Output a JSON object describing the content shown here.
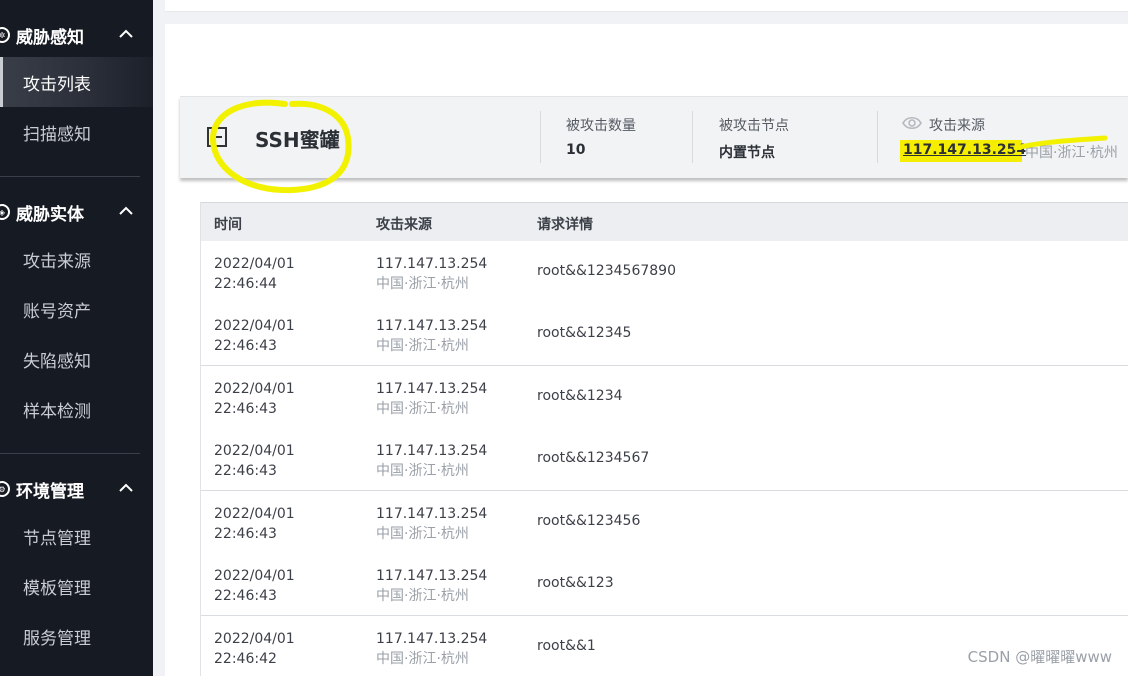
{
  "sidebar": {
    "groups": [
      {
        "title": "威胁感知",
        "items": [
          "攻击列表",
          "扫描感知"
        ]
      },
      {
        "title": "威胁实体",
        "items": [
          "攻击来源",
          "账号资产",
          "失陷感知",
          "样本检测"
        ]
      },
      {
        "title": "环境管理",
        "items": [
          "节点管理",
          "模板管理",
          "服务管理"
        ]
      }
    ]
  },
  "honeypot": {
    "title": "SSH蜜罐",
    "attacked_count_label": "被攻击数量",
    "attacked_count": "10",
    "attacked_node_label": "被攻击节点",
    "attacked_node": "内置节点",
    "source_label": "攻击来源",
    "source_ip": "117.147.13.254",
    "source_location": "中国·浙江·杭州"
  },
  "table": {
    "columns": [
      "时间",
      "攻击来源",
      "请求详情"
    ],
    "rows": [
      {
        "date": "2022/04/01",
        "time": "22:46:44",
        "ip": "117.147.13.254",
        "loc": "中国·浙江·杭州",
        "detail": "root&&1234567890"
      },
      {
        "date": "2022/04/01",
        "time": "22:46:43",
        "ip": "117.147.13.254",
        "loc": "中国·浙江·杭州",
        "detail": "root&&12345"
      },
      {
        "date": "2022/04/01",
        "time": "22:46:43",
        "ip": "117.147.13.254",
        "loc": "中国·浙江·杭州",
        "detail": "root&&1234"
      },
      {
        "date": "2022/04/01",
        "time": "22:46:43",
        "ip": "117.147.13.254",
        "loc": "中国·浙江·杭州",
        "detail": "root&&1234567"
      },
      {
        "date": "2022/04/01",
        "time": "22:46:43",
        "ip": "117.147.13.254",
        "loc": "中国·浙江·杭州",
        "detail": "root&&123456"
      },
      {
        "date": "2022/04/01",
        "time": "22:46:43",
        "ip": "117.147.13.254",
        "loc": "中国·浙江·杭州",
        "detail": "root&&123"
      },
      {
        "date": "2022/04/01",
        "time": "22:46:42",
        "ip": "117.147.13.254",
        "loc": "中国·浙江·杭州",
        "detail": "root&&1"
      }
    ]
  },
  "watermark": "CSDN @曜曜曜www",
  "colors": {
    "sidebar_bg": "#161a23",
    "highlight": "#f6ee00",
    "annotation": "#f2f200"
  }
}
